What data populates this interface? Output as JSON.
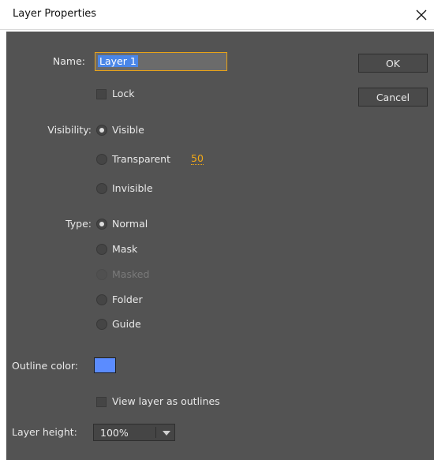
{
  "window": {
    "title": "Layer Properties"
  },
  "buttons": {
    "ok": "OK",
    "cancel": "Cancel"
  },
  "name": {
    "label": "Name:",
    "value": "Layer 1"
  },
  "lock": {
    "label": "Lock",
    "checked": false
  },
  "visibility": {
    "label": "Visibility:",
    "options": [
      "Visible",
      "Transparent",
      "Invisible"
    ],
    "selected": "Visible",
    "transparency_value": "50"
  },
  "type": {
    "label": "Type:",
    "options": [
      "Normal",
      "Mask",
      "Masked",
      "Folder",
      "Guide"
    ],
    "selected": "Normal",
    "disabled": [
      "Masked"
    ]
  },
  "outline": {
    "label": "Outline color:",
    "color": "#5b8cff",
    "view_as_outlines": {
      "label": "View layer as outlines",
      "checked": false
    }
  },
  "layer_height": {
    "label": "Layer height:",
    "value": "100%"
  },
  "colors": {
    "dialog_bg": "#535353",
    "accent_orange": "#f0a817",
    "selection_blue": "#4a86e8"
  },
  "icons": {
    "close": "close-icon",
    "dropdown": "chevron-down-icon"
  }
}
